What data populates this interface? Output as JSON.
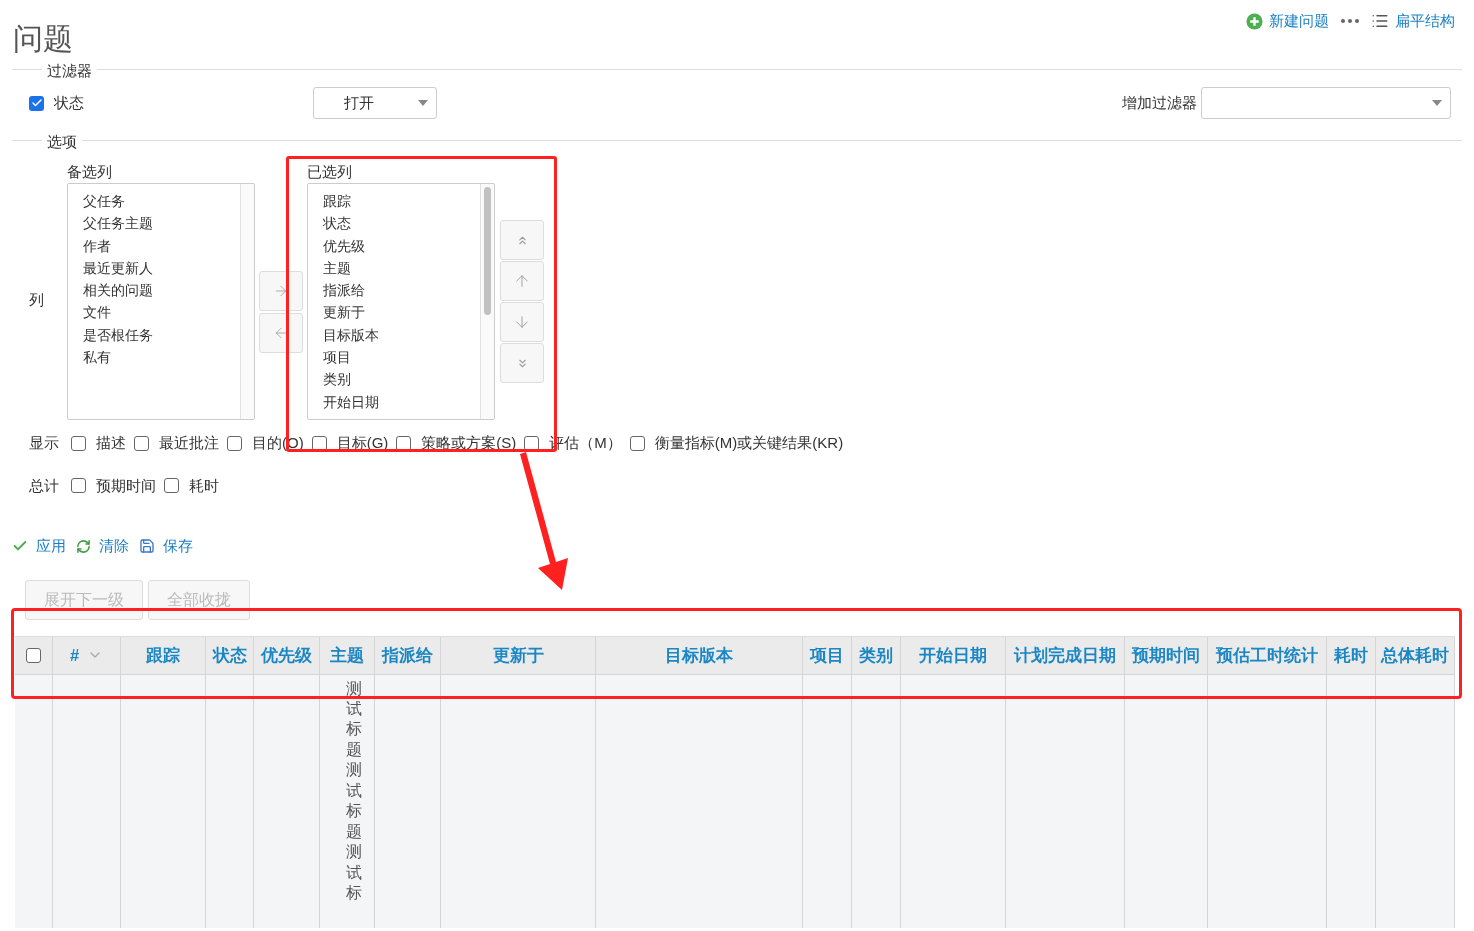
{
  "page": {
    "title": "问题"
  },
  "header_actions": [
    {
      "kind": "new",
      "label": "新建问题"
    },
    {
      "kind": "flat",
      "label": "扁平结构"
    }
  ],
  "filters": {
    "legend": "过滤器",
    "rows": [
      {
        "label": "状态",
        "checked": true,
        "value": "打开"
      }
    ],
    "add_filter": {
      "label": "增加过滤器"
    }
  },
  "options": {
    "legend": "选项",
    "columns": {
      "label": "列",
      "available": {
        "label": "备选列",
        "items": [
          "父任务",
          "父任务主题",
          "作者",
          "最近更新人",
          "相关的问题",
          "文件",
          "是否根任务",
          "私有"
        ]
      },
      "selected": {
        "label": "已选列",
        "items": [
          "跟踪",
          "状态",
          "优先级",
          "主题",
          "指派给",
          "更新于",
          "目标版本",
          "项目",
          "类别",
          "开始日期"
        ]
      }
    },
    "display": {
      "label": "显示",
      "items": [
        {
          "label": "描述",
          "checked": false
        },
        {
          "label": "最近批注",
          "checked": false
        },
        {
          "label": "目的(O)",
          "checked": false
        },
        {
          "label": "目标(G)",
          "checked": false
        },
        {
          "label": "策略或方案(S)",
          "checked": false
        },
        {
          "label": "评估（M）",
          "checked": false
        },
        {
          "label": "衡量指标(M)或关键结果(KR)",
          "checked": false
        }
      ]
    },
    "totals": {
      "label": "总计",
      "items": [
        {
          "label": "预期时间",
          "checked": false
        },
        {
          "label": "耗时",
          "checked": false
        }
      ]
    }
  },
  "actions": [
    {
      "kind": "apply",
      "label": "应用"
    },
    {
      "kind": "clear",
      "label": "清除"
    },
    {
      "kind": "save",
      "label": "保存"
    }
  ],
  "tree_buttons": [
    {
      "label": "展开下一级",
      "disabled": true
    },
    {
      "label": "全部收拢",
      "disabled": true
    }
  ],
  "table": {
    "select_all": {
      "checked": false
    },
    "columns": [
      {
        "label": "#",
        "sorted": true
      },
      {
        "label": "跟踪",
        "sorted": false
      },
      {
        "label": "状态",
        "sorted": false
      },
      {
        "label": "优先级",
        "sorted": false
      },
      {
        "label": "主题",
        "sorted": false
      },
      {
        "label": "指派给",
        "sorted": false
      },
      {
        "label": "更新于",
        "sorted": false
      },
      {
        "label": "目标版本",
        "sorted": false
      },
      {
        "label": "项目",
        "sorted": false
      },
      {
        "label": "类别",
        "sorted": false
      },
      {
        "label": "开始日期",
        "sorted": false
      },
      {
        "label": "计划完成日期",
        "sorted": false
      },
      {
        "label": "预期时间",
        "sorted": false
      },
      {
        "label": "预估工时统计",
        "sorted": false
      },
      {
        "label": "耗时",
        "sorted": false
      },
      {
        "label": "总体耗时",
        "sorted": false
      }
    ],
    "rows": [
      {
        "subject": "测试标题测试标题测试标"
      }
    ]
  },
  "annotations": [
    {
      "kind": "box"
    },
    {
      "kind": "box"
    },
    {
      "kind": "arrow"
    }
  ]
}
